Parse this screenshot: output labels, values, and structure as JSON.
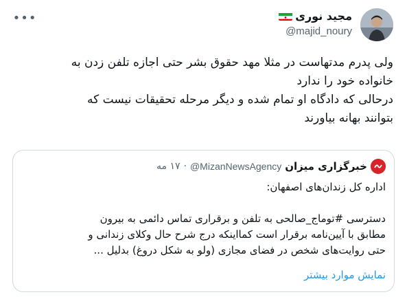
{
  "author": {
    "name": "مجید نوری",
    "handle": "@majid_noury",
    "flag_icon": "iran-flag-icon"
  },
  "more_icon": "more-dots-icon",
  "tweet": {
    "lines": [
      "ولی پدرم مدتهاست در مثلا مهد حقوق بشر حتی اجازه تلفن زدن به",
      "خانواده خود را ندارد",
      "درحالی که دادگاه او تمام شده و دیگر مرحله تحقیقات نیست که",
      "بتوانند بهانه بیاورند"
    ]
  },
  "quote": {
    "name": "خبرگزاری میزان",
    "handle": "@MizanNewsAgency",
    "separator": "·",
    "date": "۱۷ مه",
    "body_title": "اداره کل زندان‌های اصفهان:",
    "body_lines": [
      "دسترسی #توماج_صالحی به تلفن و برقراری تماس دائمی به بیرون",
      "مطابق با آیین‌نامه برقرار است کمااینکه درج شرح حال وکلای زندانی و",
      "حتی روایت‌های شخص در فضای مجازی (ولو به شکل دروغ) بدلیل ..."
    ],
    "show_more": "نمایش موارد بیشتر"
  },
  "colors": {
    "text": "#0f1419",
    "secondary": "#536471",
    "link": "#1d9bf0",
    "border": "#cfd9de",
    "mizan_red": "#d8232a"
  }
}
